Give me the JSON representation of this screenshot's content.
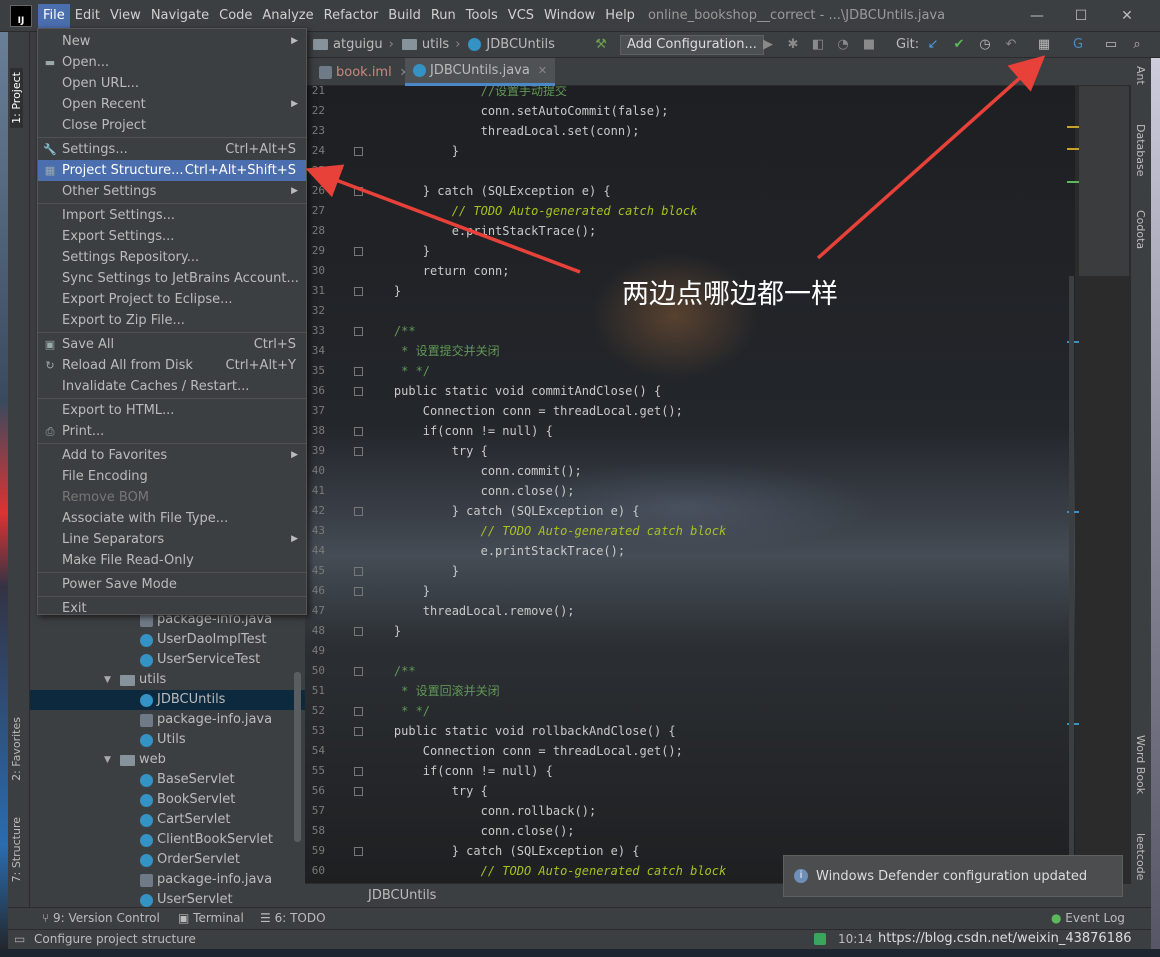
{
  "window": {
    "app_logo": "IJ",
    "title": "online_bookshop__correct - ...\\JDBCUntils.java",
    "controls": [
      "—",
      "☐",
      "✕"
    ]
  },
  "menubar": [
    "File",
    "Edit",
    "View",
    "Navigate",
    "Code",
    "Analyze",
    "Refactor",
    "Build",
    "Run",
    "Tools",
    "VCS",
    "Window",
    "Help"
  ],
  "navbar": {
    "crumbs": [
      "atguigu",
      "utils",
      "JDBCUntils"
    ],
    "add_configuration": "Add Configuration...",
    "git_label": "Git:"
  },
  "tabs": [
    {
      "label": "book.iml",
      "close": "✕"
    },
    {
      "label": "JDBCUntils.java",
      "close": "✕"
    }
  ],
  "file_menu": [
    {
      "label": "New",
      "shortcut": "",
      "submenu": true,
      "icon": ""
    },
    {
      "label": "Open...",
      "shortcut": "",
      "submenu": false,
      "icon": "folder-icon"
    },
    {
      "label": "Open URL...",
      "shortcut": "",
      "submenu": false,
      "icon": ""
    },
    {
      "label": "Open Recent",
      "shortcut": "",
      "submenu": true,
      "icon": ""
    },
    {
      "label": "Close Project",
      "shortcut": "",
      "submenu": false,
      "icon": ""
    },
    {
      "label": "Settings...",
      "shortcut": "Ctrl+Alt+S",
      "submenu": false,
      "icon": "wrench-icon"
    },
    {
      "label": "Project Structure...",
      "shortcut": "Ctrl+Alt+Shift+S",
      "submenu": false,
      "icon": "project-structure-icon",
      "highlighted": true
    },
    {
      "label": "Other Settings",
      "shortcut": "",
      "submenu": true,
      "icon": ""
    },
    {
      "label": "Import Settings...",
      "shortcut": "",
      "submenu": false,
      "icon": ""
    },
    {
      "label": "Export Settings...",
      "shortcut": "",
      "submenu": false,
      "icon": ""
    },
    {
      "label": "Settings Repository...",
      "shortcut": "",
      "submenu": false,
      "icon": ""
    },
    {
      "label": "Sync Settings to JetBrains Account...",
      "shortcut": "",
      "submenu": false,
      "icon": ""
    },
    {
      "label": "Export Project to Eclipse...",
      "shortcut": "",
      "submenu": false,
      "icon": ""
    },
    {
      "label": "Export to Zip File...",
      "shortcut": "",
      "submenu": false,
      "icon": ""
    },
    {
      "label": "Save All",
      "shortcut": "Ctrl+S",
      "submenu": false,
      "icon": "save-icon"
    },
    {
      "label": "Reload All from Disk",
      "shortcut": "Ctrl+Alt+Y",
      "submenu": false,
      "icon": "reload-icon"
    },
    {
      "label": "Invalidate Caches / Restart...",
      "shortcut": "",
      "submenu": false,
      "icon": ""
    },
    {
      "label": "Export to HTML...",
      "shortcut": "",
      "submenu": false,
      "icon": ""
    },
    {
      "label": "Print...",
      "shortcut": "",
      "submenu": false,
      "icon": "print-icon"
    },
    {
      "label": "Add to Favorites",
      "shortcut": "",
      "submenu": true,
      "icon": ""
    },
    {
      "label": "File Encoding",
      "shortcut": "",
      "submenu": false,
      "icon": ""
    },
    {
      "label": "Remove BOM",
      "shortcut": "",
      "submenu": false,
      "icon": "",
      "disabled": true
    },
    {
      "label": "Associate with File Type...",
      "shortcut": "",
      "submenu": false,
      "icon": ""
    },
    {
      "label": "Line Separators",
      "shortcut": "",
      "submenu": true,
      "icon": ""
    },
    {
      "label": "Make File Read-Only",
      "shortcut": "",
      "submenu": false,
      "icon": ""
    },
    {
      "label": "Power Save Mode",
      "shortcut": "",
      "submenu": false,
      "icon": ""
    },
    {
      "label": "Exit",
      "shortcut": "",
      "submenu": false,
      "icon": ""
    }
  ],
  "project_tree": [
    {
      "label": "package-info.java",
      "icon": "package-info-icon",
      "indent": 2
    },
    {
      "label": "UserDaoImplTest",
      "icon": "class-icon",
      "indent": 2
    },
    {
      "label": "UserServiceTest",
      "icon": "class-icon",
      "indent": 2
    },
    {
      "label": "utils",
      "icon": "folder-icon",
      "indent": 1,
      "expanded": true
    },
    {
      "label": "JDBCUntils",
      "icon": "class-icon",
      "indent": 2,
      "selected": true
    },
    {
      "label": "package-info.java",
      "icon": "package-info-icon",
      "indent": 2
    },
    {
      "label": "Utils",
      "icon": "class-icon",
      "indent": 2
    },
    {
      "label": "web",
      "icon": "folder-icon",
      "indent": 1,
      "expanded": true
    },
    {
      "label": "BaseServlet",
      "icon": "class-icon",
      "indent": 2
    },
    {
      "label": "BookServlet",
      "icon": "class-icon",
      "indent": 2
    },
    {
      "label": "CartServlet",
      "icon": "class-icon",
      "indent": 2
    },
    {
      "label": "ClientBookServlet",
      "icon": "class-icon",
      "indent": 2
    },
    {
      "label": "OrderServlet",
      "icon": "class-icon",
      "indent": 2
    },
    {
      "label": "package-info.java",
      "icon": "package-info-icon",
      "indent": 2
    },
    {
      "label": "UserServlet",
      "icon": "class-icon",
      "indent": 2
    }
  ],
  "editor": {
    "lines": [
      {
        "n": "21",
        "code": "                //设置手动提交"
      },
      {
        "n": "22",
        "code": "                conn.setAutoCommit(false);"
      },
      {
        "n": "23",
        "code": "                threadLocal.set(conn);"
      },
      {
        "n": "24",
        "code": "            }"
      },
      {
        "n": "25",
        "code": ""
      },
      {
        "n": "26",
        "code": "        } catch (SQLException e) {"
      },
      {
        "n": "27",
        "code": "            // TODO Auto-generated catch block"
      },
      {
        "n": "28",
        "code": "            e.printStackTrace();"
      },
      {
        "n": "29",
        "code": "        }"
      },
      {
        "n": "30",
        "code": "        return conn;"
      },
      {
        "n": "31",
        "code": "    }"
      },
      {
        "n": "32",
        "code": ""
      },
      {
        "n": "33",
        "code": "    /**"
      },
      {
        "n": "34",
        "code": "     * 设置提交并关闭"
      },
      {
        "n": "35",
        "code": "     * */"
      },
      {
        "n": "36",
        "code": "    public static void commitAndClose() {"
      },
      {
        "n": "37",
        "code": "        Connection conn = threadLocal.get();"
      },
      {
        "n": "38",
        "code": "        if(conn != null) {"
      },
      {
        "n": "39",
        "code": "            try {"
      },
      {
        "n": "40",
        "code": "                conn.commit();"
      },
      {
        "n": "41",
        "code": "                conn.close();"
      },
      {
        "n": "42",
        "code": "            } catch (SQLException e) {"
      },
      {
        "n": "43",
        "code": "                // TODO Auto-generated catch block"
      },
      {
        "n": "44",
        "code": "                e.printStackTrace();"
      },
      {
        "n": "45",
        "code": "            }"
      },
      {
        "n": "46",
        "code": "        }"
      },
      {
        "n": "47",
        "code": "        threadLocal.remove();"
      },
      {
        "n": "48",
        "code": "    }"
      },
      {
        "n": "49",
        "code": ""
      },
      {
        "n": "50",
        "code": "    /**"
      },
      {
        "n": "51",
        "code": "     * 设置回滚并关闭"
      },
      {
        "n": "52",
        "code": "     * */"
      },
      {
        "n": "53",
        "code": "    public static void rollbackAndClose() {"
      },
      {
        "n": "54",
        "code": "        Connection conn = threadLocal.get();"
      },
      {
        "n": "55",
        "code": "        if(conn != null) {"
      },
      {
        "n": "56",
        "code": "            try {"
      },
      {
        "n": "57",
        "code": "                conn.rollback();"
      },
      {
        "n": "58",
        "code": "                conn.close();"
      },
      {
        "n": "59",
        "code": "            } catch (SQLException e) {"
      },
      {
        "n": "60",
        "code": "                // TODO Auto-generated catch block"
      }
    ]
  },
  "annotation": "两边点哪边都一样",
  "notification": "Windows Defender configuration updated",
  "editor_breadcrumb": "JDBCUntils",
  "left_tool_tabs": [
    "1: Project",
    "2: Favorites",
    "7: Structure"
  ],
  "right_tool_tabs": [
    "Ant",
    "Database",
    "Codota",
    "Word Book",
    "leetcode"
  ],
  "bottom_tools": [
    "9: Version Control",
    "Terminal",
    "6: TODO"
  ],
  "event_log": "Event Log",
  "status": {
    "text": "Configure project structure",
    "caret": "10:14",
    "watermark": "https://blog.csdn.net/weixin_43876186"
  },
  "colors": {
    "accent": "#4b6eaf",
    "keyword": "#cc7832",
    "comment": "#629755",
    "annotation_arrow": "#e8413a"
  }
}
